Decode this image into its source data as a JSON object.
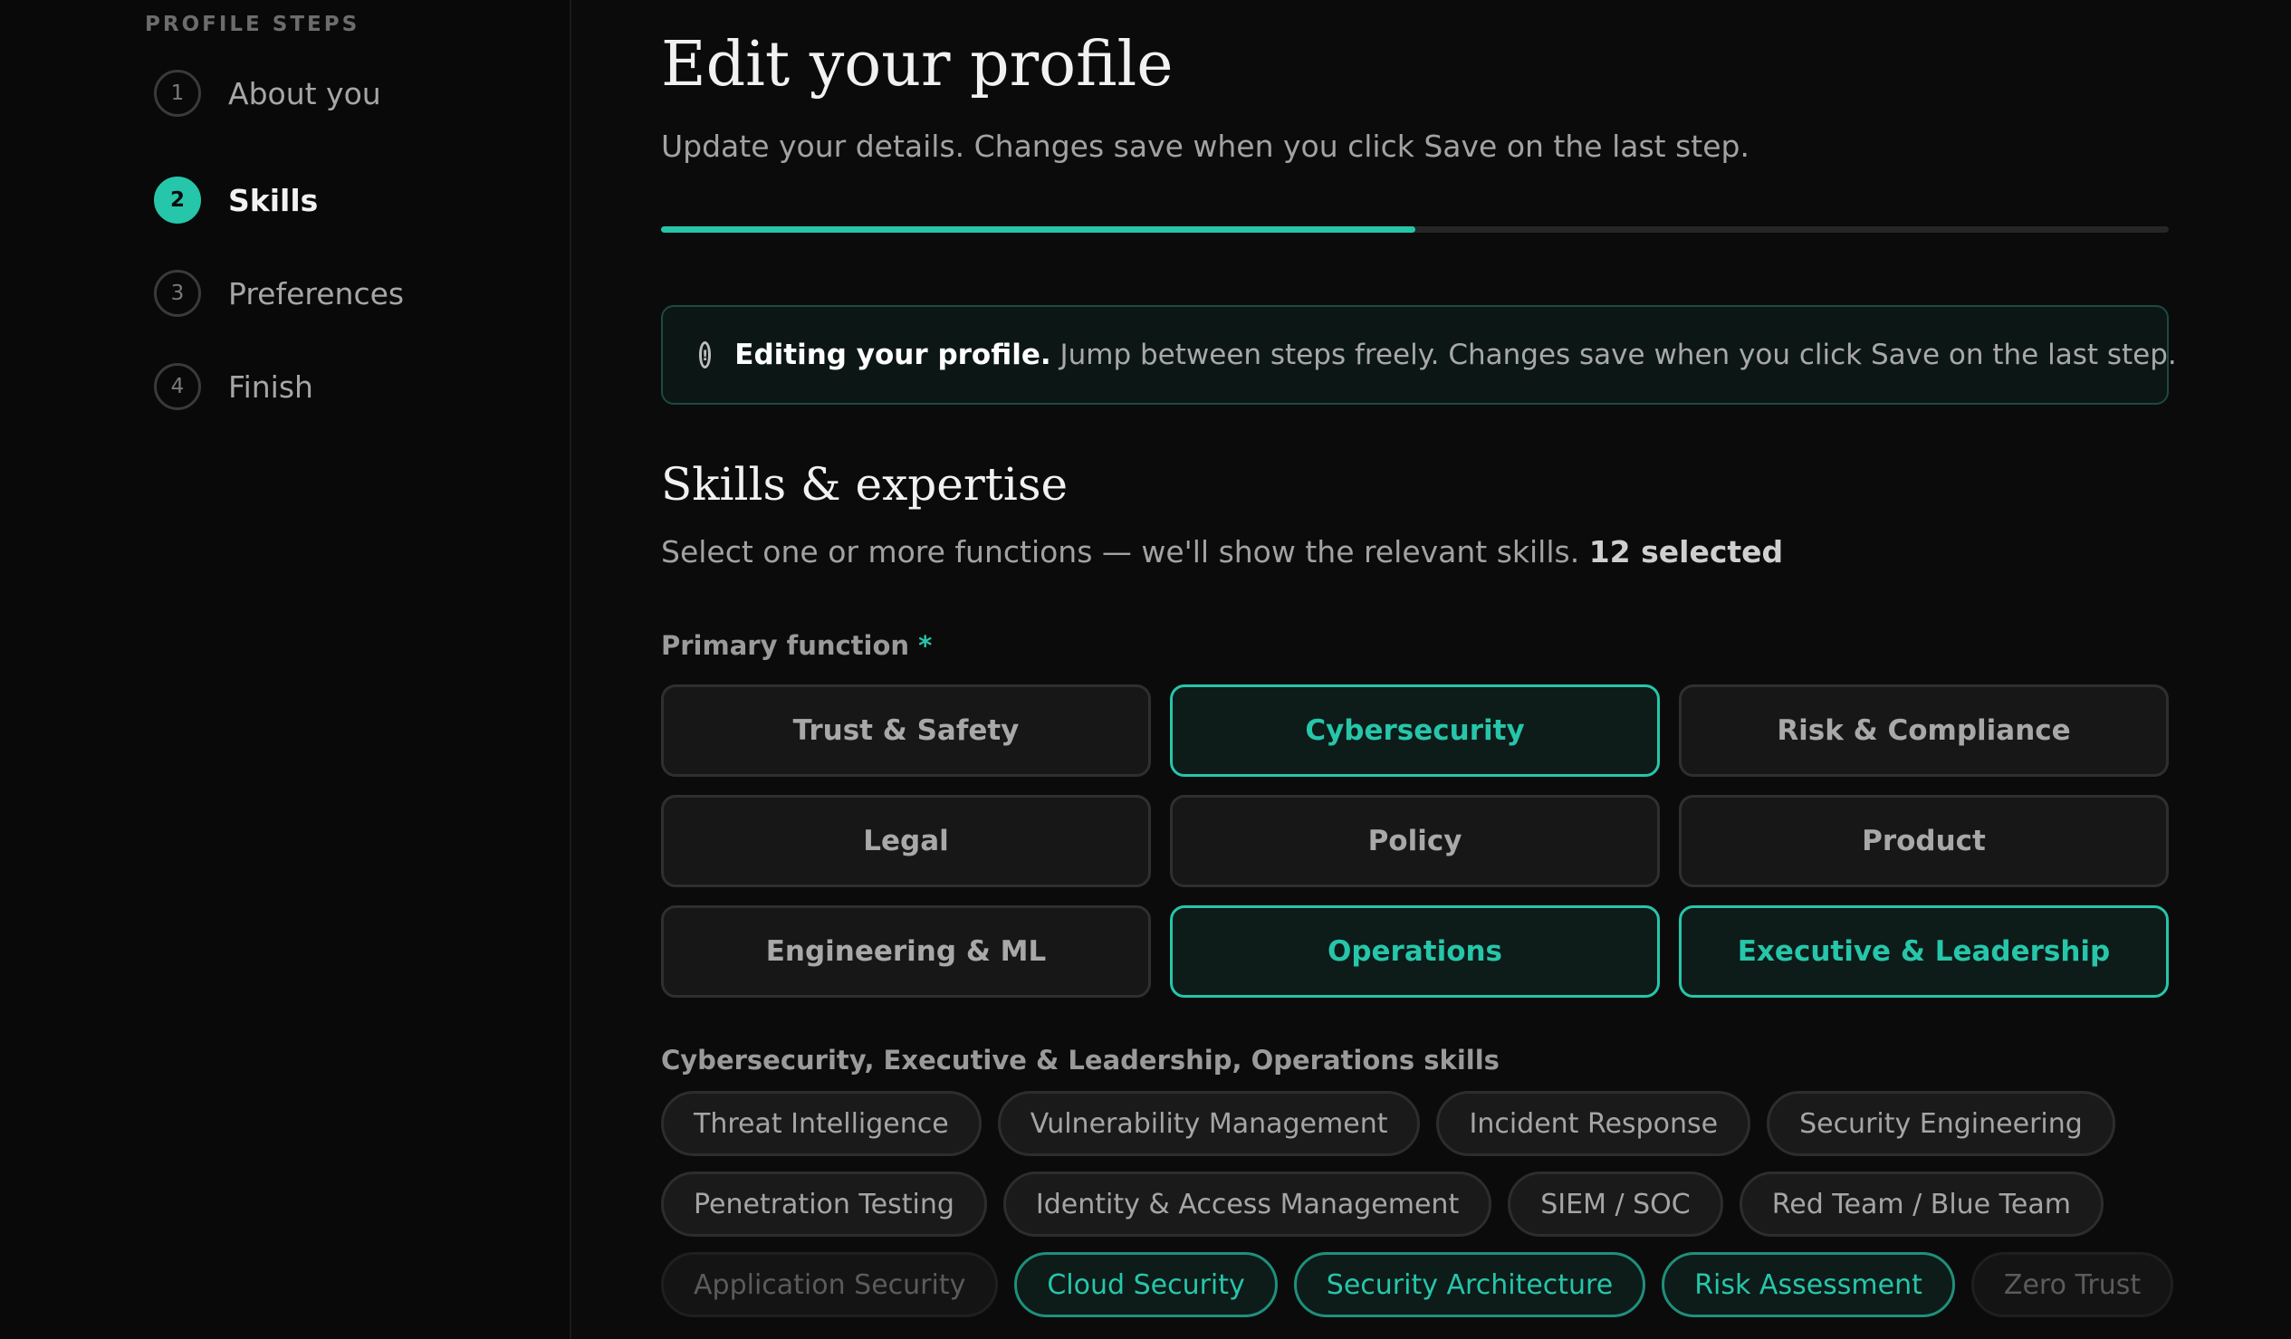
{
  "sidebar": {
    "title": "PROFILE STEPS",
    "steps": [
      {
        "num": "1",
        "label": "About you"
      },
      {
        "num": "2",
        "label": "Skills"
      },
      {
        "num": "3",
        "label": "Preferences"
      },
      {
        "num": "4",
        "label": "Finish"
      }
    ],
    "active_step": 2
  },
  "header": {
    "title": "Edit your profile",
    "subtitle": "Update your details. Changes save when you click Save on the last step.",
    "progress_fraction": 0.5
  },
  "notice": {
    "icon": "info-icon",
    "strong": "Editing your profile.",
    "text": " Jump between steps freely. Changes save when you click Save on the last step."
  },
  "section": {
    "title": "Skills & expertise",
    "subtitle": "Select one or more functions — we'll show the relevant skills. ",
    "count": "12 selected"
  },
  "primary_function": {
    "label": "Primary function",
    "required_marker": "*",
    "options": [
      {
        "label": "Trust & Safety",
        "selected": false
      },
      {
        "label": "Cybersecurity",
        "selected": true
      },
      {
        "label": "Risk & Compliance",
        "selected": false
      },
      {
        "label": "Legal",
        "selected": false
      },
      {
        "label": "Policy",
        "selected": false
      },
      {
        "label": "Product",
        "selected": false
      },
      {
        "label": "Engineering & ML",
        "selected": false
      },
      {
        "label": "Operations",
        "selected": true
      },
      {
        "label": "Executive & Leadership",
        "selected": true
      }
    ]
  },
  "skills": {
    "label": "Cybersecurity, Executive & Leadership, Operations skills",
    "rows": [
      [
        {
          "label": "Threat Intelligence",
          "state": "default"
        },
        {
          "label": "Vulnerability Management",
          "state": "default"
        },
        {
          "label": "Incident Response",
          "state": "default"
        },
        {
          "label": "Security Engineering",
          "state": "default"
        }
      ],
      [
        {
          "label": "Penetration Testing",
          "state": "default"
        },
        {
          "label": "Identity & Access Management",
          "state": "default"
        },
        {
          "label": "SIEM / SOC",
          "state": "default"
        },
        {
          "label": "Red Team / Blue Team",
          "state": "default"
        }
      ],
      [
        {
          "label": "Application Security",
          "state": "dim"
        },
        {
          "label": "Cloud Security",
          "state": "selected"
        },
        {
          "label": "Security Architecture",
          "state": "selected"
        },
        {
          "label": "Risk Assessment",
          "state": "selected"
        },
        {
          "label": "Zero Trust",
          "state": "dim"
        }
      ]
    ]
  },
  "colors": {
    "accent": "#26c6aa",
    "background": "#0b0b0b"
  }
}
